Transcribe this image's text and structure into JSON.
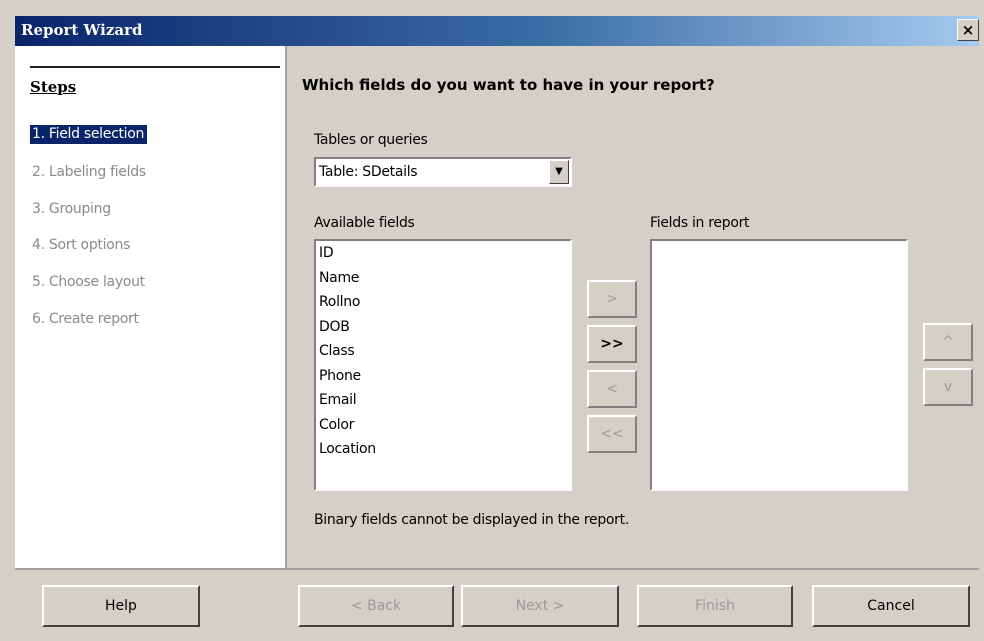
{
  "window": {
    "title": "Report Wizard",
    "close_glyph": "×",
    "close_icon": "close-icon"
  },
  "steps": {
    "heading": "Steps",
    "items": [
      {
        "label": "1. Field selection",
        "active": true
      },
      {
        "label": "2. Labeling fields",
        "active": false
      },
      {
        "label": "3. Grouping",
        "active": false
      },
      {
        "label": "4. Sort options",
        "active": false
      },
      {
        "label": "5. Choose layout",
        "active": false
      },
      {
        "label": "6. Create report",
        "active": false
      }
    ]
  },
  "main": {
    "title": "Which fields do you want to have in your report?",
    "tables_label": "Tables or queries",
    "tables_value": "Table: SDetails",
    "available_label": "Available fields",
    "available_fields": [
      "ID",
      "Name",
      "Rollno",
      "DOB",
      "Class",
      "Phone",
      "Email",
      "Color",
      "Location"
    ],
    "report_label": "Fields in report",
    "report_fields": [],
    "note": "Binary fields cannot be displayed in the report."
  },
  "move_buttons": {
    "add": ">",
    "add_all": ">>",
    "remove": "<",
    "remove_all": "<<",
    "up": "^",
    "down": "v"
  },
  "footer": {
    "help": "Help",
    "back": "< Back",
    "next": "Next >",
    "finish": "Finish",
    "cancel": "Cancel"
  }
}
